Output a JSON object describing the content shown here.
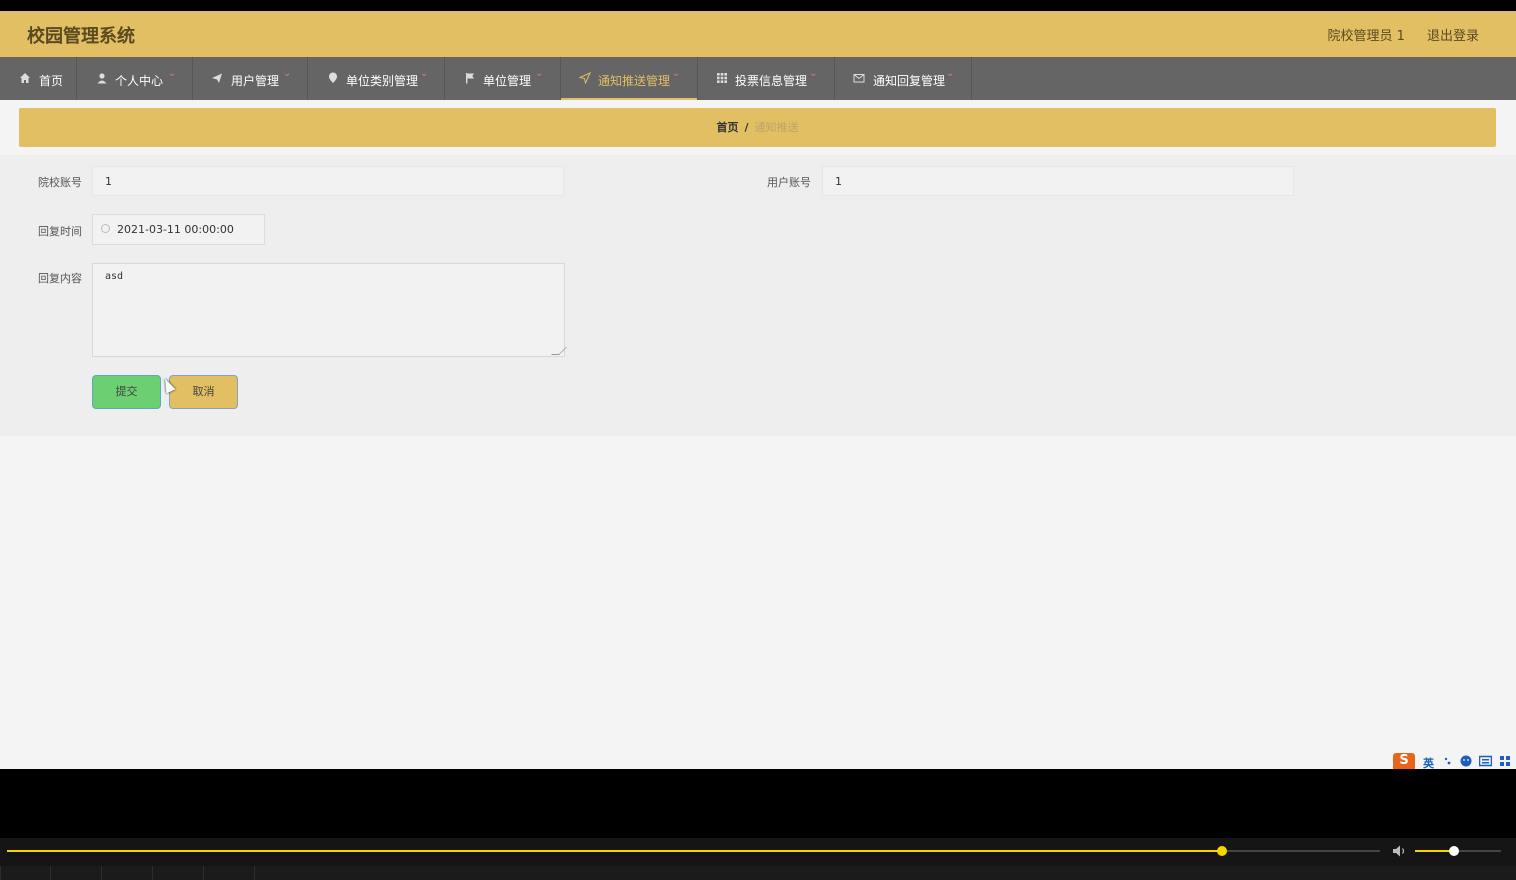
{
  "app": {
    "title": "校园管理系统"
  },
  "header": {
    "user_label": "院校管理员 1",
    "logout_label": "退出登录"
  },
  "nav": {
    "items": [
      {
        "label": "首页",
        "icon": "home-icon"
      },
      {
        "label": "个人中心",
        "icon": "user-icon"
      },
      {
        "label": "用户管理",
        "icon": "send-icon"
      },
      {
        "label": "单位类别管理",
        "icon": "location-pin-icon"
      },
      {
        "label": "单位管理",
        "icon": "flag-icon"
      },
      {
        "label": "通知推送管理",
        "icon": "navigation-arrow-icon",
        "active": true
      },
      {
        "label": "投票信息管理",
        "icon": "grid-icon"
      },
      {
        "label": "通知回复管理",
        "icon": "mail-icon"
      }
    ],
    "chevron": "⌄"
  },
  "breadcrumb": {
    "home": "首页",
    "separator": "/",
    "current": "通知推送"
  },
  "form": {
    "school_account": {
      "label": "院校账号",
      "value": "1"
    },
    "user_account": {
      "label": "用户账号",
      "value": "1"
    },
    "reply_time": {
      "label": "回复时间",
      "value": "2021-03-11 00:00:00"
    },
    "reply_content": {
      "label": "回复内容",
      "value": "asd"
    },
    "submit_label": "提交",
    "cancel_label": "取消"
  },
  "ime": {
    "logo": "S",
    "mode": "英"
  },
  "player": {
    "progress": 0.885,
    "volume": 0.45
  },
  "colors": {
    "brand": "#e2bf63",
    "nav_bg": "#656565",
    "submit": "#6ccf72"
  }
}
